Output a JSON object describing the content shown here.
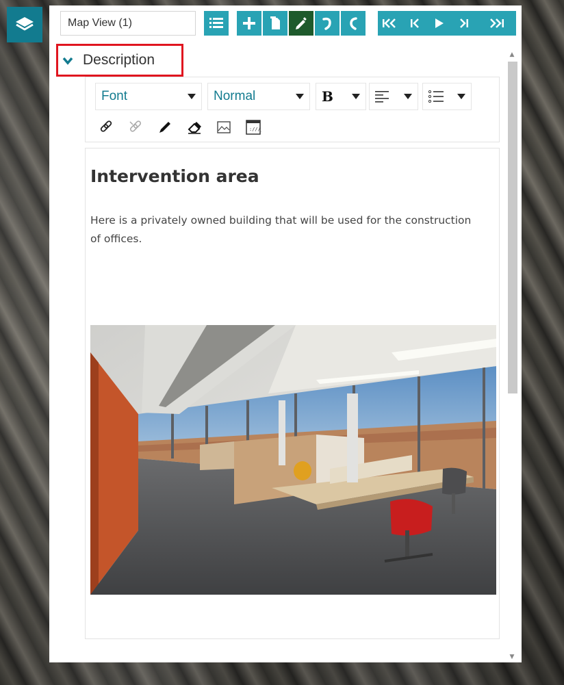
{
  "app": {
    "layers_icon": "layers-icon"
  },
  "toolbar": {
    "view_name": "Map View (1)",
    "buttons": [
      {
        "name": "list-icon"
      },
      {
        "name": "add-icon"
      },
      {
        "name": "copy-icon"
      },
      {
        "name": "edit-icon",
        "active": true
      },
      {
        "name": "undo-icon"
      },
      {
        "name": "redo-icon"
      },
      {
        "name": "first-icon"
      },
      {
        "name": "previous-icon"
      },
      {
        "name": "play-icon"
      },
      {
        "name": "next-icon"
      },
      {
        "name": "last-icon"
      }
    ]
  },
  "section": {
    "label": "Description",
    "expanded": true
  },
  "editor": {
    "font_select": "Font",
    "size_select": "Normal",
    "bold_label": "B",
    "tools": [
      "link-icon",
      "unlink-icon",
      "pen-icon",
      "eraser-icon",
      "image-icon",
      "source-icon"
    ]
  },
  "document": {
    "heading": "Intervention area",
    "body": "Here is a privately owned building that will be used for the construction of offices.",
    "image": "office-photo"
  },
  "colors": {
    "accent": "#29a3b4",
    "active": "#1e5a2c",
    "highlight": "#e0151f",
    "teal": "#127b8f"
  }
}
